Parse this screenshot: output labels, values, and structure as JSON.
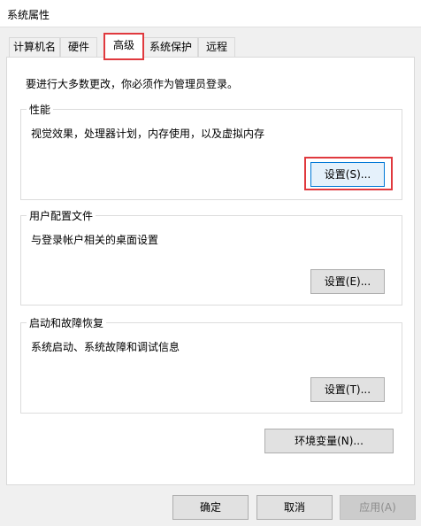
{
  "window": {
    "title": "系统属性"
  },
  "tabs": [
    {
      "label": "计算机名"
    },
    {
      "label": "硬件"
    },
    {
      "label": "高级"
    },
    {
      "label": "系统保护"
    },
    {
      "label": "远程"
    }
  ],
  "active_tab": "高级",
  "advanced": {
    "admin_note": "要进行大多数更改，你必须作为管理员登录。",
    "performance": {
      "title": "性能",
      "description": "视觉效果，处理器计划，内存使用，以及虚拟内存",
      "button": "设置(S)..."
    },
    "user_profiles": {
      "title": "用户配置文件",
      "description": "与登录帐户相关的桌面设置",
      "button": "设置(E)..."
    },
    "startup_recovery": {
      "title": "启动和故障恢复",
      "description": "系统启动、系统故障和调试信息",
      "button": "设置(T)..."
    },
    "env_button": "环境变量(N)..."
  },
  "footer": {
    "ok": "确定",
    "cancel": "取消",
    "apply": "应用(A)"
  },
  "colors": {
    "highlight": "#e0393e",
    "focus_border": "#0078d7"
  }
}
